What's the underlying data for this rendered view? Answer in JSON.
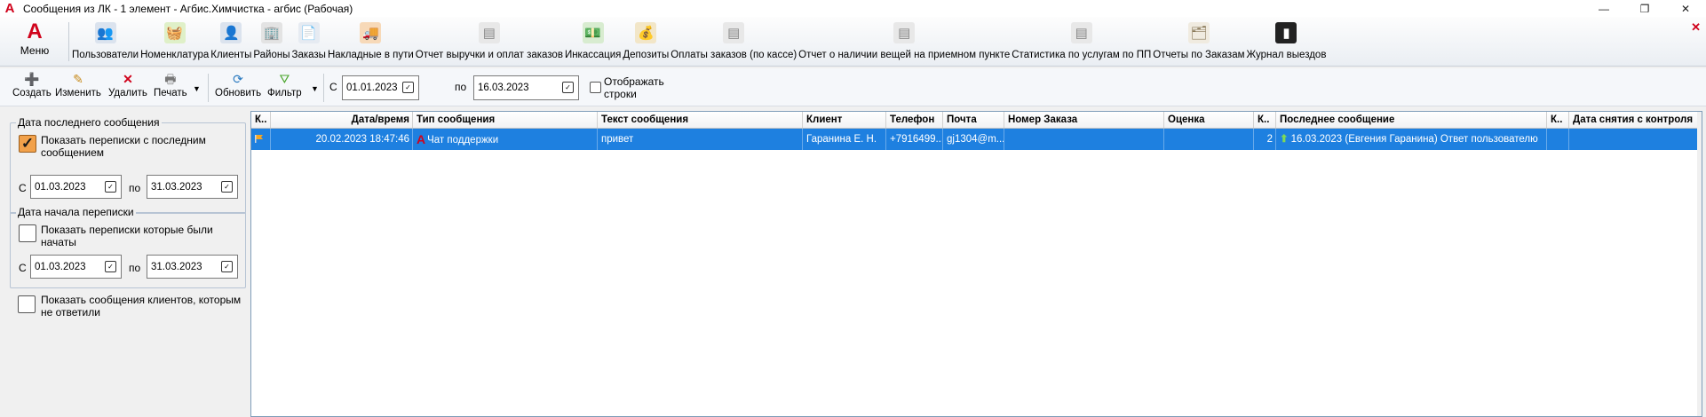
{
  "window": {
    "title": "Сообщения из ЛК - 1 элемент - Агбис.Химчистка - агбис (Рабочая)",
    "logo": "А",
    "minimize": "—",
    "restore": "❐",
    "close": "✕"
  },
  "ribbon": {
    "menu": {
      "icon_text": "А",
      "label": "Меню"
    },
    "close_x": "✕",
    "items": [
      {
        "label": "Пользователи",
        "icon": "users-icon"
      },
      {
        "label": "Номенклатура",
        "icon": "basket-icon"
      },
      {
        "label": "Клиенты",
        "icon": "clients-icon"
      },
      {
        "label": "Районы",
        "icon": "buildings-icon"
      },
      {
        "label": "Заказы",
        "icon": "orders-icon"
      },
      {
        "label": "Накладные в пути",
        "icon": "truck-icon"
      },
      {
        "label": "Отчет выручки и оплат заказов",
        "icon": "report-icon"
      },
      {
        "label": "Инкассация",
        "icon": "money-icon"
      },
      {
        "label": "Депозиты",
        "icon": "deposit-icon"
      },
      {
        "label": "Оплаты заказов (по кассе)",
        "icon": "report-icon"
      },
      {
        "label": "Отчет о наличии вещей на приемном пункте",
        "icon": "report-icon"
      },
      {
        "label": "Статистика по услугам по ПП",
        "icon": "report-icon"
      },
      {
        "label": "Отчеты по Заказам",
        "icon": "reports-icon"
      },
      {
        "label": "Журнал выездов",
        "icon": "journal-icon"
      }
    ]
  },
  "toolbar": {
    "create": "Создать",
    "edit": "Изменить",
    "delete": "Удалить",
    "print": "Печать",
    "refresh": "Обновить",
    "filter": "Фильтр",
    "from_label": "С",
    "to_label": "по",
    "date_from": "01.01.2023",
    "date_to": "16.03.2023",
    "show_rows_label": "Отображать строки",
    "show_rows_checked": false
  },
  "filters": {
    "last_message": {
      "title": "Дата последнего сообщения",
      "checkbox_label": "Показать переписки с последним сообщением",
      "checked": true,
      "from_label": "С",
      "date_from": "01.03.2023",
      "to_label": "по",
      "date_to": "31.03.2023"
    },
    "start": {
      "title": "Дата начала переписки",
      "checkbox_label": "Показать переписки которые были начаты",
      "checked": false,
      "from_label": "С",
      "date_from": "01.03.2023",
      "to_label": "по",
      "date_to": "31.03.2023"
    },
    "unanswered": {
      "checkbox_label": "Показать сообщения клиентов, которым не ответили",
      "checked": false
    }
  },
  "grid": {
    "columns": [
      "К..",
      "Дата/время",
      "Тип сообщения",
      "Текст сообщения",
      "Клиент",
      "Телефон",
      "Почта",
      "Номер Заказа",
      "Оценка",
      "К..",
      "Последнее сообщение",
      "К..",
      "Дата снятия с контроля"
    ],
    "rows": [
      {
        "datetime": "20.02.2023 18:47:46",
        "type_icon": "А",
        "type": "Чат поддержки",
        "text": "привет",
        "client": "Гаранина Е. Н.",
        "phone": "+7916499...",
        "email": "gj1304@m...",
        "order_number": "",
        "rating": "",
        "count": "2",
        "last_message": "16.03.2023 (Евгения Гаранина) Ответ пользователю",
        "k2": "",
        "control_removed": "",
        "selected": true
      }
    ]
  },
  "colors": {
    "accent_red": "#d0021b",
    "selection_blue": "#1e80e0",
    "checkbox_orange": "#f2a14a"
  }
}
